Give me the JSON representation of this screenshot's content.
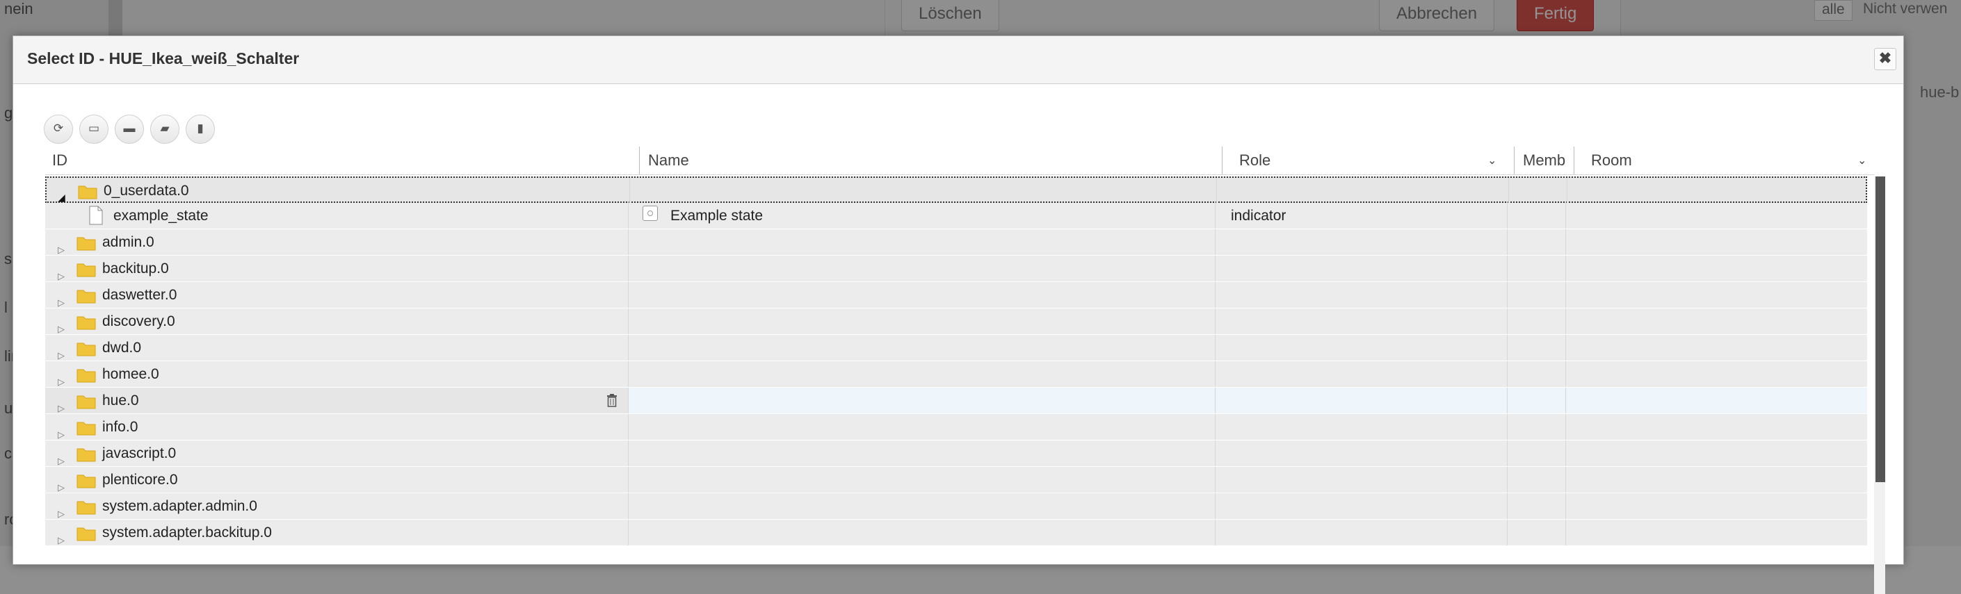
{
  "background": {
    "left_texts": [
      "nein",
      "g",
      "s",
      "l",
      "lin",
      "ul",
      "co",
      "ro"
    ],
    "buttons": {
      "delete": "Löschen",
      "cancel": "Abbrechen",
      "done": "Fertig"
    },
    "filter_all": "alle",
    "filter_unused": "Nicht verwen",
    "side_label": "hue-b"
  },
  "dialog": {
    "title": "Select ID - HUE_Ikea_weiß_Schalter",
    "close_symbol": "✖"
  },
  "toolbar": [
    {
      "icon": "refresh-icon",
      "glyph": "⟳"
    },
    {
      "icon": "list-icon",
      "glyph": "▭"
    },
    {
      "icon": "folder-icon",
      "glyph": "▬"
    },
    {
      "icon": "folder-open-icon",
      "glyph": "▰"
    },
    {
      "icon": "book-icon",
      "glyph": "▮"
    }
  ],
  "columns": {
    "id": "ID",
    "name": "Name",
    "role": "Role",
    "members": "Memb",
    "room": "Room",
    "dropdown_glyph": "⌄"
  },
  "rows": [
    {
      "id": "0_userdata.0",
      "type": "folder",
      "expanded": true,
      "name": "",
      "role": ""
    },
    {
      "id": "example_state",
      "type": "state",
      "name": "Example state",
      "role": "indicator"
    },
    {
      "id": "admin.0",
      "type": "folder",
      "name": "",
      "role": ""
    },
    {
      "id": "backitup.0",
      "type": "folder",
      "name": "",
      "role": ""
    },
    {
      "id": "daswetter.0",
      "type": "folder",
      "name": "",
      "role": ""
    },
    {
      "id": "discovery.0",
      "type": "folder",
      "name": "",
      "role": ""
    },
    {
      "id": "dwd.0",
      "type": "folder",
      "name": "",
      "role": ""
    },
    {
      "id": "homee.0",
      "type": "folder",
      "name": "",
      "role": ""
    },
    {
      "id": "hue.0",
      "type": "folder",
      "name": "",
      "role": "",
      "hover": true
    },
    {
      "id": "info.0",
      "type": "folder",
      "name": "",
      "role": ""
    },
    {
      "id": "javascript.0",
      "type": "folder",
      "name": "",
      "role": ""
    },
    {
      "id": "plenticore.0",
      "type": "folder",
      "name": "",
      "role": ""
    },
    {
      "id": "system.adapter.admin.0",
      "type": "folder",
      "name": "",
      "role": ""
    },
    {
      "id": "system.adapter.backitup.0",
      "type": "folder",
      "name": "",
      "role": ""
    }
  ],
  "colors": {
    "folder": "#f0c43a",
    "folder_dark": "#d9a514",
    "accent_button": "#d9534f",
    "scroll_thumb": "#555555"
  }
}
